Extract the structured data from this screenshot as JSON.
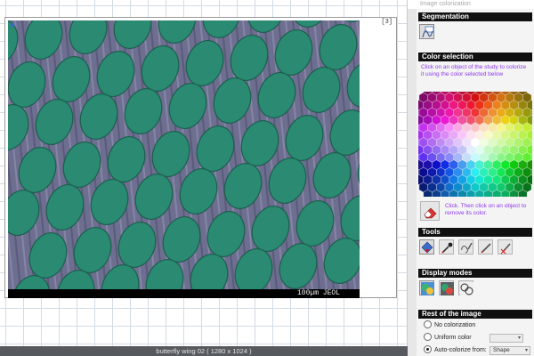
{
  "panel": {
    "title": "Image colorization",
    "segmentation": {
      "header": "Segmentation"
    },
    "color_selection": {
      "header": "Color selection",
      "hint": "Click on an object of the study to colorize it using the color selected below",
      "eraser_hint": "Click. Then click on an object to remove its color."
    },
    "tools": {
      "header": "Tools",
      "icons": [
        "pointer-fill-icon",
        "eyedropper-icon",
        "lasso-pencil-icon",
        "pencil-icon",
        "pencil-eraser-icon"
      ]
    },
    "display_modes": {
      "header": "Display modes",
      "icons": [
        "colorized-mode-icon",
        "overlay-mode-icon",
        "outline-mode-icon"
      ]
    },
    "rest_of_image": {
      "header": "Rest of the image",
      "options": [
        {
          "label": "No colorization",
          "checked": false
        },
        {
          "label": "Uniform color",
          "checked": false
        },
        {
          "label": "Auto-colorize from:",
          "checked": true
        }
      ],
      "auto_from_value": "Shape"
    }
  },
  "canvas": {
    "frame_index": "[3]",
    "sem_label": "100µm JEOL",
    "scale_color": "#b7cbea",
    "scale_color_scale_color": "#b7cbea",
    "colors": {
      "scale_fill": "#2a8a72",
      "ridges": "#6e6e90",
      "background": "#000000"
    }
  },
  "status": {
    "file_label": "butterfly wing 02 ( 1280 x 1024 )"
  }
}
